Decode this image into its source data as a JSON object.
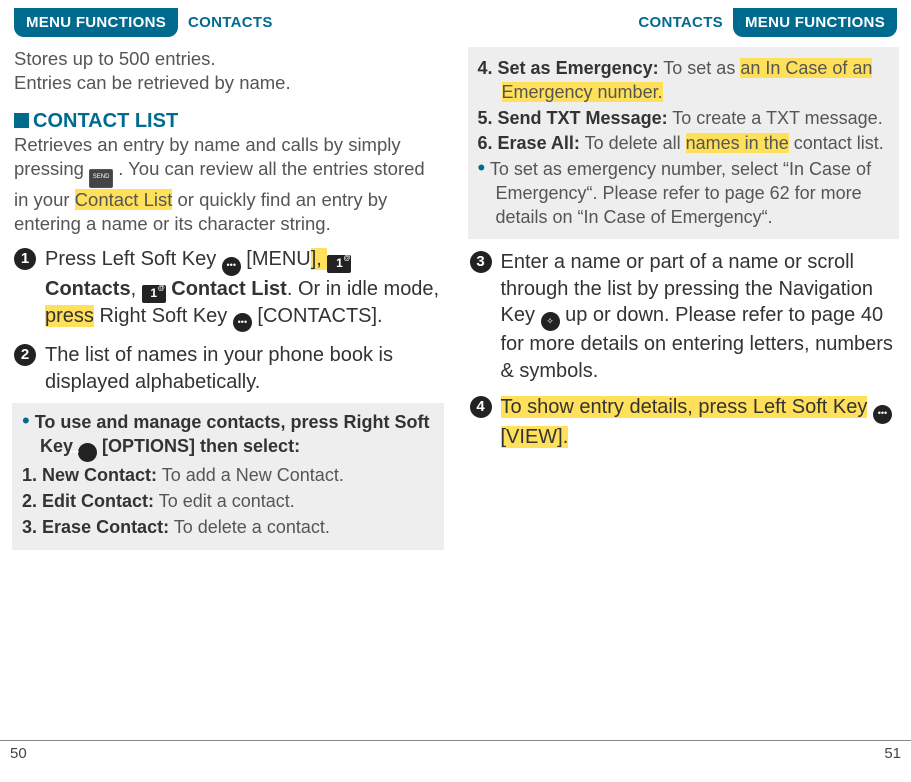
{
  "header": {
    "menu_functions": "MENU FUNCTIONS",
    "contacts": "CONTACTS"
  },
  "left": {
    "intro1": "Stores up to 500 entries.",
    "intro2": "Entries can be retrieved by name.",
    "section_title": "CONTACT LIST",
    "para": {
      "a": "Retrieves an entry by name and calls by simply pressing ",
      "b": " . You can review all the entries stored in your ",
      "c": "Contact List",
      "d": " or quickly find an entry by entering a name or its character string."
    },
    "step1": {
      "a": "Press Left Soft Key ",
      "b": " [MENU",
      "c": "], ",
      "d": " Contacts",
      "e": ", ",
      "f": " Contact List",
      "g": ". Or in idle mode, ",
      "h": "press",
      "i": " Right Soft Key ",
      "j": " [CONTACTS]."
    },
    "step2": "The list of names in your phone book is displayed alphabetically.",
    "box": {
      "lead_a": "To use and manage contacts, press Right Soft Key ",
      "lead_b": " [OPTIONS] then select:",
      "o1n": "1.",
      "o1t": "New Contact:",
      "o1d": " To add a New Contact.",
      "o2n": "2.",
      "o2t": "Edit Contact:",
      "o2d": " To edit a contact.",
      "o3n": "3.",
      "o3t": "Erase Contact:",
      "o3d": " To delete a contact."
    }
  },
  "right": {
    "box": {
      "o4n": "4.",
      "o4t": "Set as Emergency:",
      "o4d_a": " To set as ",
      "o4d_b": "an In Case of an Emergency number.",
      "o5n": "5.",
      "o5t": "Send TXT Message:",
      "o5d": " To create a TXT message.",
      "o6n": "6.",
      "o6t": "Erase All:",
      "o6d_a": " To delete all ",
      "o6d_b": "names in the",
      "o6d_c": " contact list.",
      "note": "To set as emergency number, select “In Case of Emergency“. Please refer to page 62 for more details on “In Case of Emergency“."
    },
    "step3": {
      "a": "Enter a name or part of a name or scroll through the list by pressing the Navigation Key ",
      "b": " up or down. Please refer to page 40 for more details on entering letters, numbers & symbols."
    },
    "step4": {
      "a": "To show entry details, press Left Soft Key",
      "b": " [VIEW]."
    }
  },
  "footer": {
    "left": "50",
    "right": "51"
  },
  "numbers": {
    "n1": "1",
    "n2": "2",
    "n3": "3",
    "n4": "4"
  },
  "one_badge": "1"
}
